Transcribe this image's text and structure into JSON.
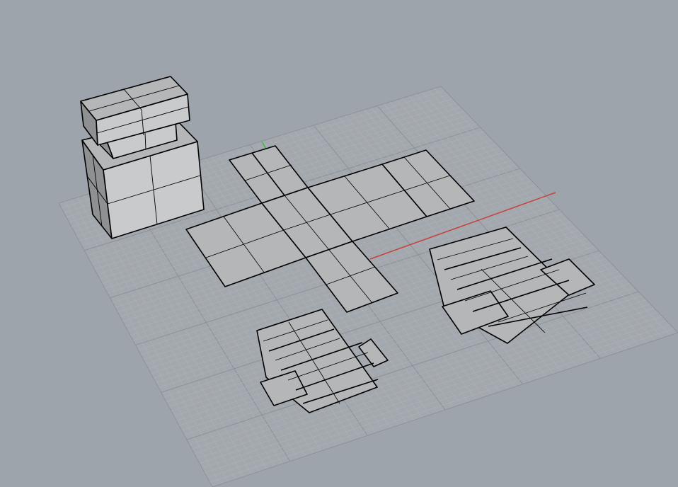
{
  "viewport": {
    "background": "#9ea4ab",
    "grid_minor_color": "#aeb2b7",
    "grid_major_color": "#8a8f95",
    "x_axis_color": "#c4443a",
    "y_axis_color": "#3db83d",
    "face_light": "#c9cacb",
    "face_mid": "#b5b6b7",
    "face_dark": "#8f9091",
    "edge_color": "#000000"
  },
  "scene": {
    "objects": [
      "box-3d",
      "lid-3d",
      "box-unfolded-net",
      "lid-unfolded-net-right",
      "lid-unfolded-net-small"
    ]
  }
}
